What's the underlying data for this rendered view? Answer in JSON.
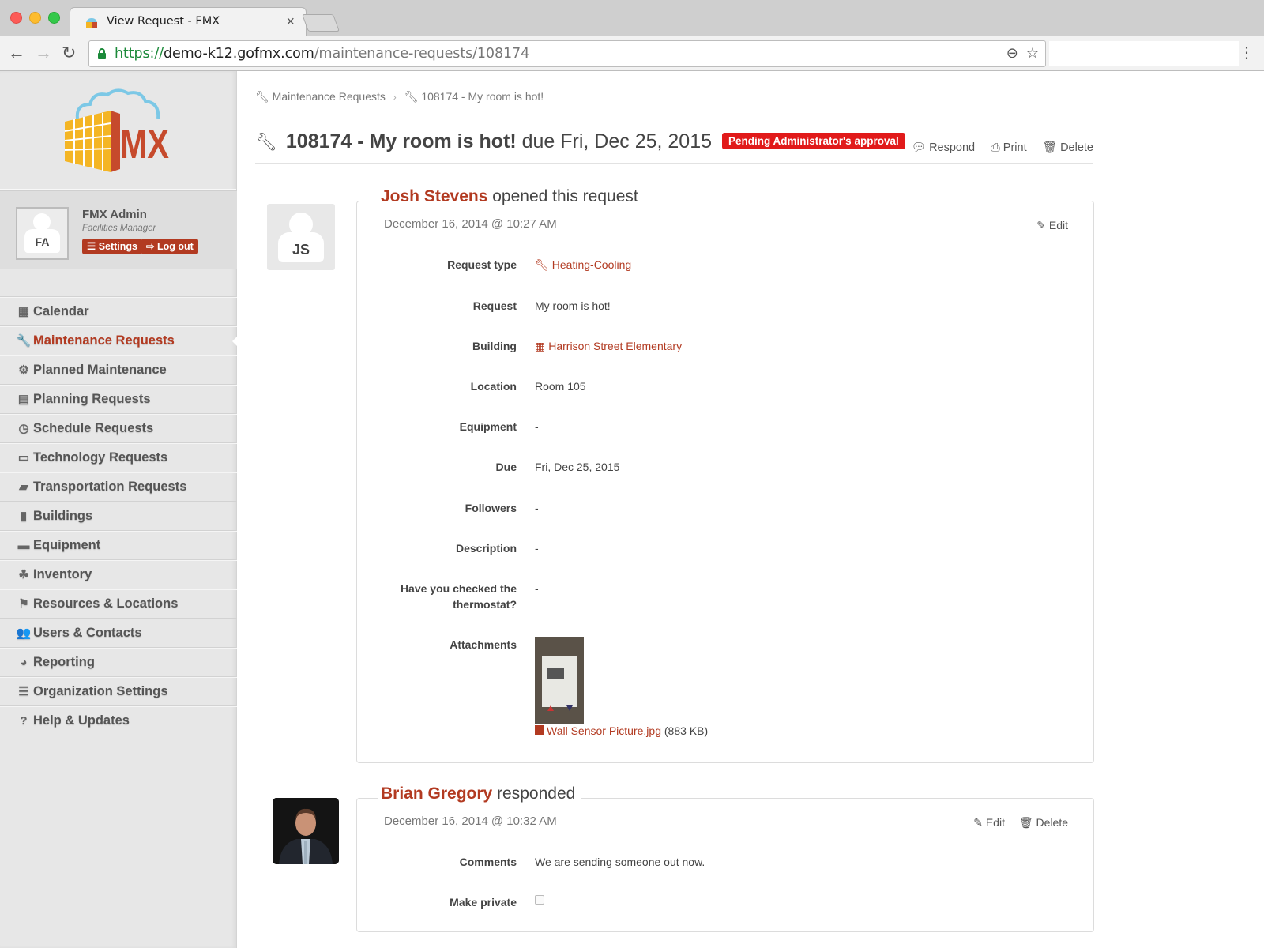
{
  "browser": {
    "tab_title": "View Request - FMX",
    "url_scheme": "https://",
    "url_host": "demo-k12.gofmx.com",
    "url_path": "/maintenance-requests/108174"
  },
  "sidebar": {
    "user": {
      "initials": "FA",
      "name": "FMX Admin",
      "role": "Facilities Manager",
      "settings_label": "Settings",
      "logout_label": "Log out"
    },
    "items": [
      {
        "label": "Calendar",
        "icon": "calendar-icon",
        "glyph": "▦",
        "active": false
      },
      {
        "label": "Maintenance Requests",
        "icon": "wrench-icon",
        "glyph": "🔧",
        "active": true
      },
      {
        "label": "Planned Maintenance",
        "icon": "cogs-icon",
        "glyph": "⚙",
        "active": false
      },
      {
        "label": "Planning Requests",
        "icon": "newspaper-icon",
        "glyph": "▤",
        "active": false
      },
      {
        "label": "Schedule Requests",
        "icon": "clock-icon",
        "glyph": "◷",
        "active": false
      },
      {
        "label": "Technology Requests",
        "icon": "laptop-icon",
        "glyph": "▭",
        "active": false
      },
      {
        "label": "Transportation Requests",
        "icon": "truck-icon",
        "glyph": "▰",
        "active": false
      },
      {
        "label": "Buildings",
        "icon": "building-icon",
        "glyph": "▮",
        "active": false
      },
      {
        "label": "Equipment",
        "icon": "briefcase-icon",
        "glyph": "▬",
        "active": false
      },
      {
        "label": "Inventory",
        "icon": "cubes-icon",
        "glyph": "☘",
        "active": false
      },
      {
        "label": "Resources & Locations",
        "icon": "flag-icon",
        "glyph": "⚑",
        "active": false
      },
      {
        "label": "Users & Contacts",
        "icon": "users-icon",
        "glyph": "👥",
        "active": false
      },
      {
        "label": "Reporting",
        "icon": "pie-chart-icon",
        "glyph": "◕",
        "active": false
      },
      {
        "label": "Organization Settings",
        "icon": "sliders-icon",
        "glyph": "☰",
        "active": false
      },
      {
        "label": "Help & Updates",
        "icon": "question-circle-icon",
        "glyph": "?",
        "active": false
      }
    ]
  },
  "breadcrumb": {
    "items": [
      "Maintenance Requests",
      "108174 - My room is hot!"
    ],
    "separator": "›"
  },
  "header": {
    "title_strong": "108174 - My room is hot!",
    "title_due": "due Fri, Dec 25, 2015",
    "status_badge": "Pending Administrator's approval",
    "status_color": "#e11a1a",
    "actions": {
      "respond": "Respond",
      "print": "Print",
      "delete": "Delete"
    }
  },
  "entries": [
    {
      "author": "Josh Stevens",
      "author_initials": "JS",
      "verb": "opened this request",
      "date": "December 16, 2014 @ 10:27 AM",
      "actions": {
        "edit": "Edit"
      },
      "fields": [
        {
          "label": "Request type",
          "value": "Heating-Cooling"
        },
        {
          "label": "Request",
          "value": "My room is hot!"
        },
        {
          "label": "Building",
          "value": "Harrison Street Elementary"
        },
        {
          "label": "Location",
          "value": "Room 105"
        },
        {
          "label": "Equipment",
          "value": "-"
        },
        {
          "label": "Due",
          "value": "Fri, Dec 25, 2015"
        },
        {
          "label": "Followers",
          "value": "-"
        },
        {
          "label": "Description",
          "value": "-"
        },
        {
          "label": "Have you checked the thermostat?",
          "value": "-"
        },
        {
          "label": "Attachments",
          "file_name": "Wall Sensor Picture.jpg",
          "file_size": "(883 KB)"
        }
      ]
    },
    {
      "author": "Brian Gregory",
      "verb": "responded",
      "date": "December 16, 2014 @ 10:32 AM",
      "actions": {
        "edit": "Edit",
        "delete": "Delete"
      },
      "fields": [
        {
          "label": "Comments",
          "value": "We are sending someone out now."
        },
        {
          "label": "Make private",
          "checked": false
        }
      ]
    }
  ],
  "colors": {
    "brand": "#b23a21",
    "sidebar_bg": "#e7e7e7"
  }
}
